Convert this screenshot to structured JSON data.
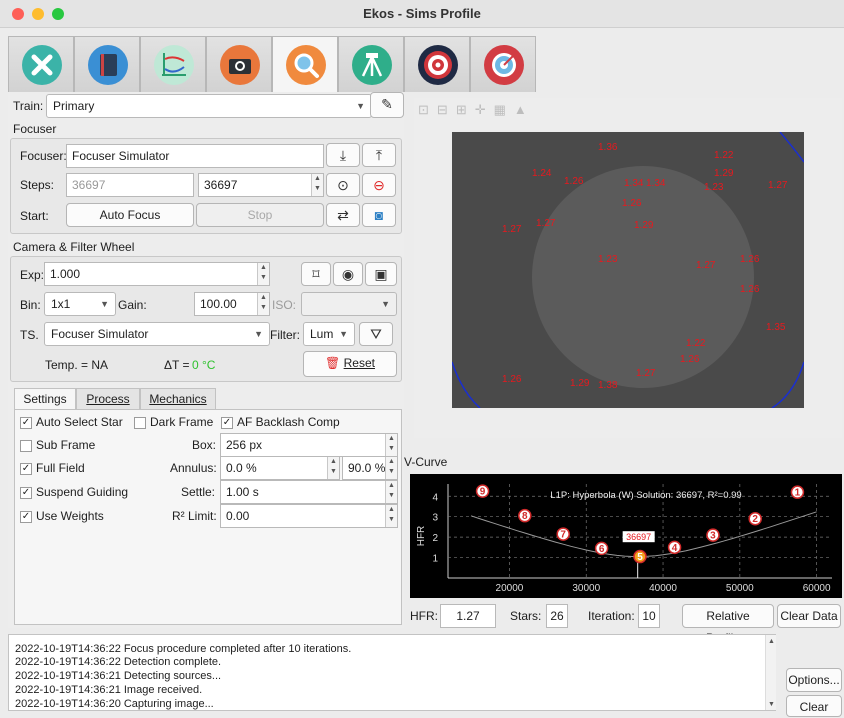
{
  "window": {
    "title": "Ekos - Sims Profile"
  },
  "tabs": [
    {
      "name": "setup",
      "color": "#3bb3a8"
    },
    {
      "name": "scheduler",
      "color": "#3a8fd4"
    },
    {
      "name": "analyze",
      "color": "#2a9d6e"
    },
    {
      "name": "capture",
      "color": "#e9773b"
    },
    {
      "name": "focus",
      "color": "#f08a3e"
    },
    {
      "name": "mount",
      "color": "#2fae8a"
    },
    {
      "name": "align",
      "color": "#d0363b"
    },
    {
      "name": "guide",
      "color": "#d23c43"
    }
  ],
  "train": {
    "label": "Train:",
    "value": "Primary"
  },
  "focuser_section": {
    "title": "Focuser",
    "focuser_label": "Focuser:",
    "focuser_value": "Focuser Simulator",
    "steps_label": "Steps:",
    "steps_placeholder": "36697",
    "steps_value": "36697",
    "start_label": "Start:",
    "autofocus": "Auto Focus",
    "stop": "Stop"
  },
  "camera_section": {
    "title": "Camera & Filter Wheel",
    "exp_label": "Exp:",
    "exp_value": "1.000",
    "bin_label": "Bin:",
    "bin_value": "1x1",
    "gain_label": "Gain:",
    "gain_value": "100.00",
    "iso_label": "ISO:",
    "ts_label": "TS.",
    "ts_value": "Focuser Simulator",
    "filter_label": "Filter:",
    "filter_value": "Lum",
    "temp": "Temp. = NA",
    "delta_label": "ΔT = ",
    "delta_value": "0 °C",
    "reset": "Reset"
  },
  "settings_tabs": [
    "Settings",
    "Process",
    "Mechanics"
  ],
  "settings": {
    "auto_select_star": "Auto Select Star",
    "dark_frame": "Dark Frame",
    "af_backlash": "AF Backlash Comp",
    "sub_frame": "Sub Frame",
    "box_label": "Box:",
    "box_value": "256 px",
    "full_field": "Full Field",
    "annulus_label": "Annulus:",
    "annulus_min": "0.0 %",
    "annulus_max": "90.0 %",
    "suspend_guiding": "Suspend Guiding",
    "settle_label": "Settle:",
    "settle_value": "1.00 s",
    "use_weights": "Use Weights",
    "r2_label": "R² Limit:",
    "r2_value": "0.00"
  },
  "hfr_labels": [
    {
      "t": "1.36"
    },
    {
      "t": "1.22"
    },
    {
      "t": "1.29"
    },
    {
      "t": "1.24"
    },
    {
      "t": "1.26"
    },
    {
      "t": "1.34"
    },
    {
      "t": "1.27"
    },
    {
      "t": "1.23"
    },
    {
      "t": "1.34"
    },
    {
      "t": "1.26"
    },
    {
      "t": "1.27"
    },
    {
      "t": "1.27"
    },
    {
      "t": "1.29"
    },
    {
      "t": "1.23"
    },
    {
      "t": "1.27"
    },
    {
      "t": "1.26"
    },
    {
      "t": "1.26"
    },
    {
      "t": "1.35"
    },
    {
      "t": "1.22"
    },
    {
      "t": "1.26"
    },
    {
      "t": "1.27"
    },
    {
      "t": "1.26"
    },
    {
      "t": "1.29"
    },
    {
      "t": "1.38"
    }
  ],
  "vcurve": {
    "title": "V-Curve",
    "solution": "L1P: Hyperbola (W) Solution: 36697, R²=0.99",
    "ylabel": "HFR",
    "xticks": [
      "20000",
      "30000",
      "40000",
      "50000",
      "60000"
    ],
    "yticks": [
      "4",
      "3",
      "2",
      "1"
    ],
    "min_label": "36697"
  },
  "chart_data": {
    "type": "scatter",
    "title": "L1P: Hyperbola (W) Solution: 36697, R²=0.99",
    "xlabel": "",
    "ylabel": "HFR",
    "xlim": [
      12000,
      62000
    ],
    "ylim": [
      0,
      4.6
    ],
    "series": [
      {
        "points": [
          [
            57500,
            4.2
          ],
          [
            52000,
            2.9
          ],
          [
            46500,
            2.1
          ],
          [
            41500,
            1.5
          ],
          [
            37000,
            1.05
          ],
          [
            32000,
            1.45
          ],
          [
            27000,
            2.15
          ],
          [
            22000,
            3.05
          ],
          [
            16500,
            4.25
          ]
        ]
      }
    ]
  },
  "status_row": {
    "hfr_label": "HFR:",
    "hfr_value": "1.27",
    "stars_label": "Stars:",
    "stars_value": "26",
    "iteration_label": "Iteration:",
    "iteration_value": "10",
    "relative_profile": "Relative Profile...",
    "clear_data": "Clear Data"
  },
  "log": [
    "2022-10-19T14:36:22 Focus procedure completed after 10 iterations.",
    "2022-10-19T14:36:22 Detection complete.",
    "2022-10-19T14:36:21 Detecting sources...",
    "2022-10-19T14:36:21 Image received.",
    "2022-10-19T14:36:20 Capturing image..."
  ],
  "log_buttons": {
    "options": "Options...",
    "clear": "Clear"
  }
}
